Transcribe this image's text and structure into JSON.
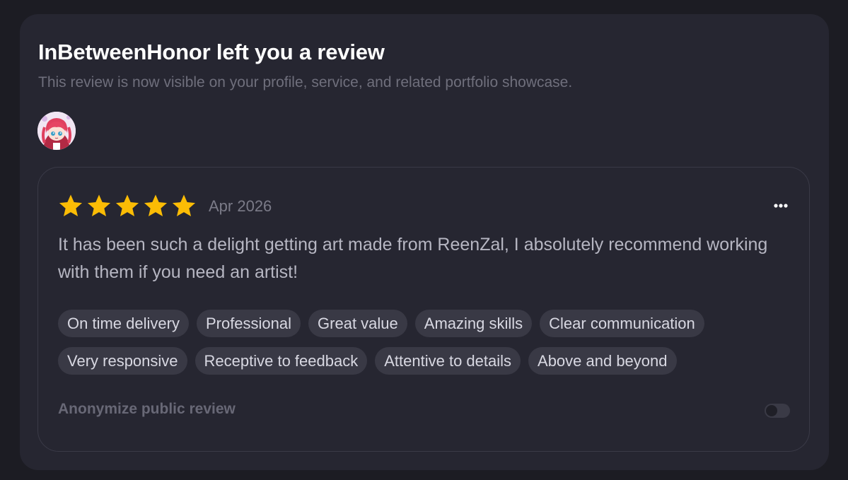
{
  "notification": {
    "title": "InBetweenHonor left you a review",
    "subtitle": "This review is now visible on your profile, service, and related portfolio showcase.",
    "avatar_icon": "reviewer-avatar"
  },
  "review": {
    "rating": 5,
    "max_rating": 5,
    "star_color": "#fbbc05",
    "date": "Apr 2026",
    "text": "It has been such a delight getting art made from ReenZal, I absolutely recommend working with them if you need an artist!",
    "more_icon": "more-horizontal-icon",
    "tags": [
      "On time delivery",
      "Professional",
      "Great value",
      "Amazing skills",
      "Clear communication",
      "Very responsive",
      "Receptive to feedback",
      "Attentive to details",
      "Above and beyond"
    ],
    "anonymize_label": "Anonymize public review",
    "anonymize_enabled": false
  }
}
